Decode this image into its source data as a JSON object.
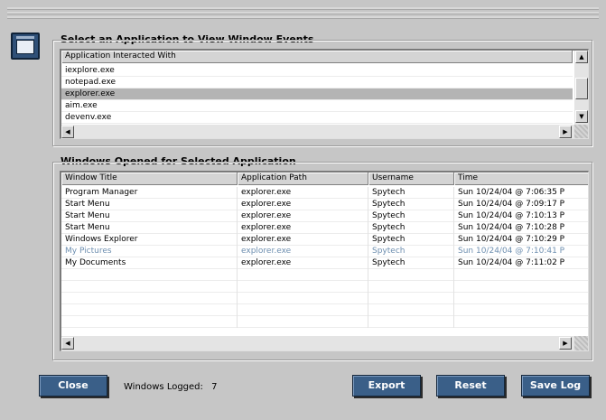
{
  "top_section": {
    "title": "Select an Application to View Window Events",
    "column": "Application Interacted With",
    "apps": [
      {
        "name": "iexplore.exe",
        "selected": false
      },
      {
        "name": "notepad.exe",
        "selected": false
      },
      {
        "name": "explorer.exe",
        "selected": true
      },
      {
        "name": "aim.exe",
        "selected": false
      },
      {
        "name": "devenv.exe",
        "selected": false
      }
    ]
  },
  "bottom_section": {
    "title": "Windows Opened for Selected Application",
    "columns": [
      "Window Title",
      "Application Path",
      "Username",
      "Time"
    ],
    "rows": [
      {
        "title": "Program Manager",
        "path": "explorer.exe",
        "user": "Spytech",
        "time": "Sun  10/24/04 @ 7:06:35 P",
        "dim": false
      },
      {
        "title": "Start Menu",
        "path": "explorer.exe",
        "user": "Spytech",
        "time": "Sun  10/24/04 @ 7:09:17 P",
        "dim": false
      },
      {
        "title": "Start Menu",
        "path": "explorer.exe",
        "user": "Spytech",
        "time": "Sun  10/24/04 @ 7:10:13 P",
        "dim": false
      },
      {
        "title": "Start Menu",
        "path": "explorer.exe",
        "user": "Spytech",
        "time": "Sun  10/24/04 @ 7:10:28 P",
        "dim": false
      },
      {
        "title": "Windows Explorer",
        "path": "explorer.exe",
        "user": "Spytech",
        "time": "Sun  10/24/04 @ 7:10:29 P",
        "dim": false
      },
      {
        "title": "My Pictures",
        "path": "explorer.exe",
        "user": "Spytech",
        "time": "Sun  10/24/04 @ 7:10:41 P",
        "dim": true
      },
      {
        "title": "My Documents",
        "path": "explorer.exe",
        "user": "Spytech",
        "time": "Sun  10/24/04 @ 7:11:02 P",
        "dim": false
      }
    ]
  },
  "footer": {
    "close_label": "Close",
    "logged_label": "Windows Logged:",
    "logged_count": "7",
    "export_label": "Export",
    "reset_label": "Reset",
    "save_label": "Save Log"
  },
  "colors": {
    "button_bg": "#3a5f88",
    "selection": "#b4b4b4",
    "dim_text": "#6e8fb0"
  },
  "icons": {
    "app": "window-app-icon",
    "scroll_up": "arrow-up-icon",
    "scroll_down": "arrow-down-icon",
    "scroll_left": "arrow-left-icon",
    "scroll_right": "arrow-right-icon"
  }
}
